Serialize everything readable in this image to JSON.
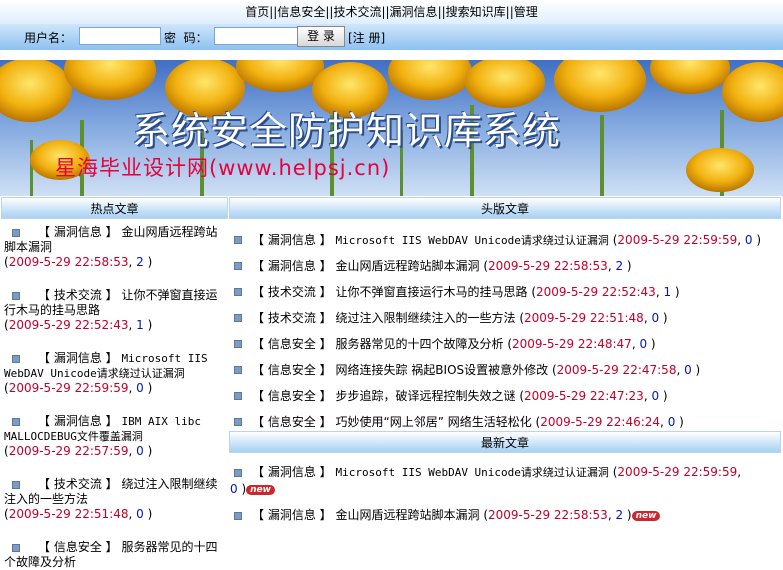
{
  "nav": [
    "首页",
    "信息安全",
    "技术交流",
    "漏洞信息",
    "搜索知识库",
    "管理"
  ],
  "login": {
    "user_label": "用户名：",
    "pwd_label": "密  码：",
    "login_button": "登 录",
    "register": "[注 册]"
  },
  "banner": {
    "title": "系统安全防护知识库系统",
    "subtitle": "星海毕业设计网(www.helpsj.cn)"
  },
  "hot": {
    "header": "热点文章",
    "items": [
      {
        "cat": "漏洞信息",
        "title": "金山网盾远程跨站脚本漏洞",
        "date": "2009-5-29 22:58:53",
        "count": "2"
      },
      {
        "cat": "技术交流",
        "title": "让你不弹窗直接运行木马的挂马思路",
        "date": "2009-5-29 22:52:43",
        "count": "1"
      },
      {
        "cat": "漏洞信息",
        "title": "Microsoft IIS WebDAV Unicode请求绕过认证漏洞",
        "date": "2009-5-29 22:59:59",
        "count": "0"
      },
      {
        "cat": "漏洞信息",
        "title": "IBM AIX libc MALLOCDEBUG文件覆盖漏洞",
        "date": "2009-5-29 22:57:59",
        "count": "0"
      },
      {
        "cat": "技术交流",
        "title": "绕过注入限制继续注入的一些方法",
        "date": "2009-5-29 22:51:48",
        "count": "0"
      },
      {
        "cat": "信息安全",
        "title": "服务器常见的十四个故障及分析",
        "date": "",
        "count": ""
      }
    ]
  },
  "top": {
    "header": "头版文章",
    "items": [
      {
        "cat": "漏洞信息",
        "title": "Microsoft IIS WebDAV Unicode请求绕过认证漏洞",
        "date": "2009-5-29 22:59:59",
        "count": "0"
      },
      {
        "cat": "漏洞信息",
        "title": "金山网盾远程跨站脚本漏洞",
        "date": "2009-5-29 22:58:53",
        "count": "2"
      },
      {
        "cat": "技术交流",
        "title": "让你不弹窗直接运行木马的挂马思路",
        "date": "2009-5-29 22:52:43",
        "count": "1"
      },
      {
        "cat": "技术交流",
        "title": "绕过注入限制继续注入的一些方法",
        "date": "2009-5-29 22:51:48",
        "count": "0"
      },
      {
        "cat": "信息安全",
        "title": "服务器常见的十四个故障及分析",
        "date": "2009-5-29 22:48:47",
        "count": "0"
      },
      {
        "cat": "信息安全",
        "title": "网络连接失踪 祸起BIOS设置被意外修改",
        "date": "2009-5-29 22:47:58",
        "count": "0"
      },
      {
        "cat": "信息安全",
        "title": "步步追踪，破译远程控制失效之谜",
        "date": "2009-5-29 22:47:23",
        "count": "0"
      },
      {
        "cat": "信息安全",
        "title": "巧妙使用“网上邻居” 网络生活轻松化",
        "date": "2009-5-29 22:46:24",
        "count": "0"
      }
    ]
  },
  "newest": {
    "header": "最新文章",
    "new_label": "new",
    "items": [
      {
        "cat": "漏洞信息",
        "title": "Microsoft IIS WebDAV Unicode请求绕过认证漏洞",
        "date": "2009-5-29 22:59:59",
        "count": "0"
      },
      {
        "cat": "漏洞信息",
        "title": "金山网盾远程跨站脚本漏洞",
        "date": "2009-5-29 22:58:53",
        "count": "2"
      }
    ]
  },
  "colors": {
    "date": "#c2002a",
    "count": "#0017b4",
    "new_badge": "#c8292c"
  }
}
